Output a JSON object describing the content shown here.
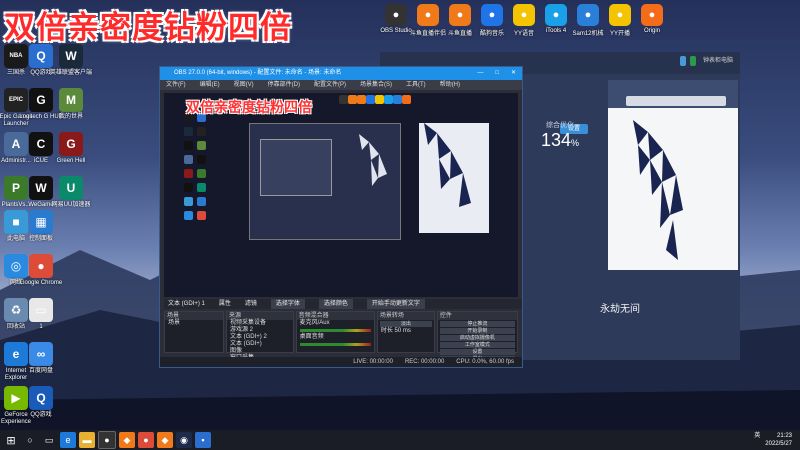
{
  "overlay_title": "双倍亲密度钻粉四倍",
  "top_icons": [
    {
      "label": "",
      "icon": "store-icon",
      "color": "#d33"
    },
    {
      "label": "",
      "icon": "game-icon",
      "color": "#3a6fd8"
    },
    {
      "label": "OBS Studio",
      "icon": "obs-icon",
      "color": "#333"
    },
    {
      "label": "斗鱼直播伴侣",
      "icon": "douyu-icon",
      "color": "#f07a1a"
    },
    {
      "label": "斗鱼直播",
      "icon": "douyu2-icon",
      "color": "#f07a1a"
    },
    {
      "label": "酷狗音乐",
      "icon": "kugou-icon",
      "color": "#1f74e8"
    },
    {
      "label": "YY语音",
      "icon": "yy-icon",
      "color": "#f5c400"
    },
    {
      "label": "iTools 4",
      "icon": "itools-icon",
      "color": "#1aa0e8"
    },
    {
      "label": "Sam12机械",
      "icon": "sam-icon",
      "color": "#2a7fd8"
    },
    {
      "label": "YY开播",
      "icon": "yy-live-icon",
      "color": "#f5c400"
    },
    {
      "label": "Origin",
      "icon": "origin-icon",
      "color": "#f46c1a"
    }
  ],
  "desktop_icons": [
    {
      "label": "三国杀",
      "icon": "nba-icon",
      "color": "#1a1a1a",
      "glyph": "NBA"
    },
    {
      "label": "QQ游戏",
      "icon": "qq-game-icon",
      "color": "#2a6fd0",
      "glyph": "Q"
    },
    {
      "label": "英雄联盟客户端",
      "icon": "lol-icon",
      "color": "#1b2a3a",
      "glyph": "W"
    },
    {
      "label": "Epic Games Launcher",
      "icon": "epic-icon",
      "color": "#222",
      "glyph": "EPIC"
    },
    {
      "label": "Logitech G HUB",
      "icon": "logitech-icon",
      "color": "#111",
      "glyph": "G"
    },
    {
      "label": "我的世界",
      "icon": "minecraft-icon",
      "color": "#5a8a3a",
      "glyph": "M"
    },
    {
      "label": "Administr...",
      "icon": "admin-icon",
      "color": "#4a6a9a",
      "glyph": "A"
    },
    {
      "label": "iCUE",
      "icon": "icue-icon",
      "color": "#111",
      "glyph": "C"
    },
    {
      "label": "Green Hell",
      "icon": "greenhell-icon",
      "color": "#8a1a1a",
      "glyph": "G"
    },
    {
      "label": "PlantsVs...",
      "icon": "plants-icon",
      "color": "#3a7a2a",
      "glyph": "P"
    },
    {
      "label": "WeGame",
      "icon": "wegame-icon",
      "color": "#111",
      "glyph": "W"
    },
    {
      "label": "网易UU加速器",
      "icon": "uu-icon",
      "color": "#0a8a6a",
      "glyph": "U"
    },
    {
      "label": "此电脑",
      "icon": "computer-icon",
      "color": "#3a9ad8",
      "glyph": "■"
    },
    {
      "label": "控制面板",
      "icon": "control-panel-icon",
      "color": "#2a7ad0",
      "glyph": "▦"
    },
    {
      "label": "网络",
      "icon": "network-icon",
      "color": "#2a8ae0",
      "glyph": "◎"
    },
    {
      "label": "Google Chrome",
      "icon": "chrome-icon",
      "color": "#dd4b39",
      "glyph": "●"
    },
    {
      "label": "回收站",
      "icon": "recycle-bin-icon",
      "color": "#6a8ab0",
      "glyph": "♻"
    },
    {
      "label": "1",
      "icon": "file-icon",
      "color": "#e8e8e8",
      "glyph": "▭"
    },
    {
      "label": "Internet Explorer",
      "icon": "ie-icon",
      "color": "#1e7ad8",
      "glyph": "e"
    },
    {
      "label": "百度网盘",
      "icon": "baidu-icon",
      "color": "#3a8ae8",
      "glyph": "∞"
    },
    {
      "label": "GeForce Experience",
      "icon": "geforce-icon",
      "color": "#76b900",
      "glyph": "▶"
    },
    {
      "label": "QQ游戏",
      "icon": "qq-game-icon",
      "color": "#1a5ab8",
      "glyph": "Q"
    }
  ],
  "obs": {
    "title": "OBS 27.0.0 (64-bit, windows) - 配置文件: 未命名 - 场景: 未命名",
    "menu": [
      "文件(F)",
      "编辑(E)",
      "视图(V)",
      "停靠部件(D)",
      "配置文件(P)",
      "场景集合(S)",
      "工具(T)",
      "帮助(H)"
    ],
    "preview_caption": "双倍亲密度钻粉四倍",
    "source_bar": [
      "文本 (GDI+) 1",
      "属性",
      "滤镜",
      "选择字体",
      "选择颜色",
      "开始手动更新文字"
    ],
    "docks": {
      "scenes": {
        "title": "场景",
        "items": [
          "场景"
        ]
      },
      "sources": {
        "title": "来源",
        "items": [
          "视频采集设备",
          "游戏源 2",
          "文本 (GDI+) 2",
          "文本 (GDI+)",
          "图像",
          "窗口采集"
        ]
      },
      "mixer": {
        "title": "音频混合器",
        "items": [
          "麦克风/Aux",
          "桌面音频"
        ]
      },
      "transitions": {
        "title": "场景转场",
        "type": "淡出",
        "duration_label": "时长",
        "duration": "50 ms"
      },
      "controls": {
        "title": "控件",
        "buttons": [
          "停止推流",
          "开始录制",
          "启动虚拟摄像机",
          "工作室模式",
          "设置",
          "退出"
        ]
      }
    },
    "status": [
      "LIVE: 00:00:00",
      "REC: 00:00:00",
      "CPU: 0.0%, 60.00 fps"
    ]
  },
  "bg_app": {
    "settings_btn": "设置",
    "stat_label": "综合优化",
    "stat_value": "134",
    "stat_unit": "%",
    "bottom_text": "永劫无间",
    "pills": [
      "",
      "",
      "钟表柜电脑"
    ]
  },
  "taskbar": {
    "lang": "英",
    "time": "21:23",
    "date": "2022/5/27"
  }
}
